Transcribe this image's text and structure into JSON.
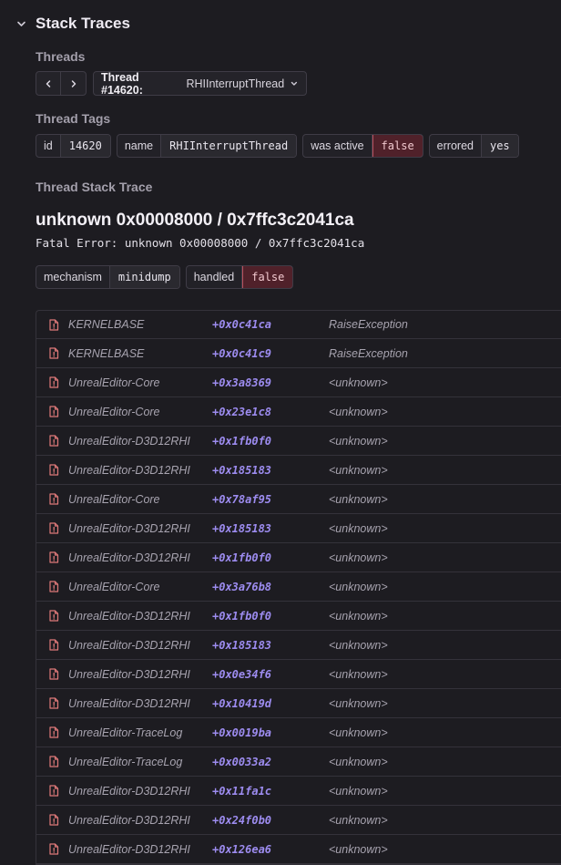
{
  "section": {
    "title": "Stack Traces"
  },
  "threads": {
    "label": "Threads",
    "selector_id": "Thread #14620:",
    "selector_name": "RHIInterruptThread"
  },
  "thread_tags": {
    "label": "Thread Tags",
    "tags": [
      {
        "key": "id",
        "value": "14620",
        "flag": false
      },
      {
        "key": "name",
        "value": "RHIInterruptThread",
        "flag": false
      },
      {
        "key": "was active",
        "value": "false",
        "flag": true
      },
      {
        "key": "errored",
        "value": "yes",
        "flag": false
      }
    ]
  },
  "stack_trace": {
    "label": "Thread Stack Trace",
    "title": "unknown 0x00008000 / 0x7ffc3c2041ca",
    "subtitle": "Fatal Error: unknown 0x00008000 / 0x7ffc3c2041ca",
    "mechanism": [
      {
        "key": "mechanism",
        "value": "minidump",
        "flag": false
      },
      {
        "key": "handled",
        "value": "false",
        "flag": true
      }
    ]
  },
  "colors": {
    "accent": "#9d8cf0",
    "danger_bg": "#50212a",
    "danger_border": "#b8505e",
    "icon": "#e07a7a"
  },
  "frames": [
    {
      "module": "KERNELBASE",
      "offset": "+0x0c41ca",
      "function": "RaiseException"
    },
    {
      "module": "KERNELBASE",
      "offset": "+0x0c41c9",
      "function": "RaiseException"
    },
    {
      "module": "UnrealEditor-Core",
      "offset": "+0x3a8369",
      "function": "<unknown>"
    },
    {
      "module": "UnrealEditor-Core",
      "offset": "+0x23e1c8",
      "function": "<unknown>"
    },
    {
      "module": "UnrealEditor-D3D12RHI",
      "offset": "+0x1fb0f0",
      "function": "<unknown>"
    },
    {
      "module": "UnrealEditor-D3D12RHI",
      "offset": "+0x185183",
      "function": "<unknown>"
    },
    {
      "module": "UnrealEditor-Core",
      "offset": "+0x78af95",
      "function": "<unknown>"
    },
    {
      "module": "UnrealEditor-D3D12RHI",
      "offset": "+0x185183",
      "function": "<unknown>"
    },
    {
      "module": "UnrealEditor-D3D12RHI",
      "offset": "+0x1fb0f0",
      "function": "<unknown>"
    },
    {
      "module": "UnrealEditor-Core",
      "offset": "+0x3a76b8",
      "function": "<unknown>"
    },
    {
      "module": "UnrealEditor-D3D12RHI",
      "offset": "+0x1fb0f0",
      "function": "<unknown>"
    },
    {
      "module": "UnrealEditor-D3D12RHI",
      "offset": "+0x185183",
      "function": "<unknown>"
    },
    {
      "module": "UnrealEditor-D3D12RHI",
      "offset": "+0x0e34f6",
      "function": "<unknown>"
    },
    {
      "module": "UnrealEditor-D3D12RHI",
      "offset": "+0x10419d",
      "function": "<unknown>"
    },
    {
      "module": "UnrealEditor-TraceLog",
      "offset": "+0x0019ba",
      "function": "<unknown>"
    },
    {
      "module": "UnrealEditor-TraceLog",
      "offset": "+0x0033a2",
      "function": "<unknown>"
    },
    {
      "module": "UnrealEditor-D3D12RHI",
      "offset": "+0x11fa1c",
      "function": "<unknown>"
    },
    {
      "module": "UnrealEditor-D3D12RHI",
      "offset": "+0x24f0b0",
      "function": "<unknown>"
    },
    {
      "module": "UnrealEditor-D3D12RHI",
      "offset": "+0x126ea6",
      "function": "<unknown>"
    }
  ]
}
